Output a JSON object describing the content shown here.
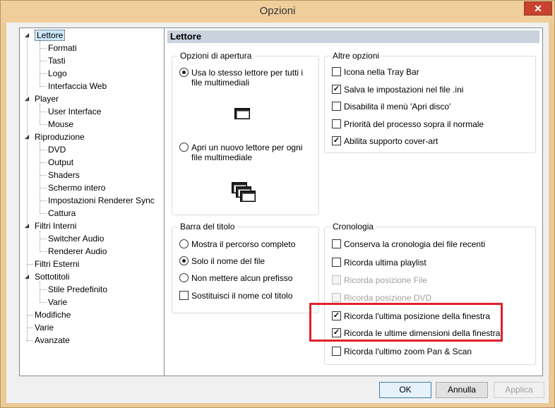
{
  "window": {
    "title": "Opzioni",
    "close_glyph": "✕"
  },
  "tree": {
    "items": [
      {
        "label": "Lettore",
        "level": 0,
        "expanded": true,
        "selected": true
      },
      {
        "label": "Formati",
        "level": 1
      },
      {
        "label": "Tasti",
        "level": 1
      },
      {
        "label": "Logo",
        "level": 1
      },
      {
        "label": "Interfaccia Web",
        "level": 1
      },
      {
        "label": "Player",
        "level": 0,
        "expanded": true
      },
      {
        "label": "User Interface",
        "level": 1
      },
      {
        "label": "Mouse",
        "level": 1
      },
      {
        "label": "Riproduzione",
        "level": 0,
        "expanded": true
      },
      {
        "label": "DVD",
        "level": 1
      },
      {
        "label": "Output",
        "level": 1
      },
      {
        "label": "Shaders",
        "level": 1
      },
      {
        "label": "Schermo intero",
        "level": 1
      },
      {
        "label": "Impostazioni Renderer Sync",
        "level": 1
      },
      {
        "label": "Cattura",
        "level": 1
      },
      {
        "label": "Filtri Interni",
        "level": 0,
        "expanded": true
      },
      {
        "label": "Switcher Audio",
        "level": 1
      },
      {
        "label": "Renderer Audio",
        "level": 1
      },
      {
        "label": "Filtri Esterni",
        "level": 0
      },
      {
        "label": "Sottotitoli",
        "level": 0,
        "expanded": true
      },
      {
        "label": "Stile Predefinito",
        "level": 1
      },
      {
        "label": "Varie",
        "level": 1
      },
      {
        "label": "Modifiche",
        "level": 0
      },
      {
        "label": "Varie",
        "level": 0
      },
      {
        "label": "Avanzate",
        "level": 0
      }
    ]
  },
  "page": {
    "header": "Lettore",
    "apertura": {
      "title": "Opzioni di apertura",
      "opt1": "Usa lo stesso lettore per tutti i file multimediali",
      "opt1_checked": true,
      "opt2": "Apri un nuovo lettore per ogni file multimediale",
      "opt2_checked": false
    },
    "altre": {
      "title": "Altre opzioni",
      "items": [
        {
          "label": "Icona nella Tray Bar",
          "checked": false
        },
        {
          "label": "Salva le impostazioni nel file .ini",
          "checked": true
        },
        {
          "label": "Disabilita il menù 'Apri disco'",
          "checked": false
        },
        {
          "label": "Priorità del processo sopra il normale",
          "checked": false
        },
        {
          "label": "Abilita supporto cover-art",
          "checked": true
        }
      ]
    },
    "titolo": {
      "title": "Barra del titolo",
      "radios": [
        {
          "label": "Mostra il percorso completo",
          "checked": false
        },
        {
          "label": "Solo il nome del file",
          "checked": true
        },
        {
          "label": "Non mettere alcun prefisso",
          "checked": false
        }
      ],
      "checkbox": {
        "label": "Sostituisci il nome col titolo",
        "checked": false
      }
    },
    "cronologia": {
      "title": "Cronologia",
      "items": [
        {
          "label": "Conserva la cronologia dei file recenti",
          "checked": false,
          "disabled": false
        },
        {
          "label": "Ricorda ultima playlist",
          "checked": false,
          "disabled": false
        },
        {
          "label": "Ricorda posizione File",
          "checked": false,
          "disabled": true
        },
        {
          "label": "Ricorda posizione DVD",
          "checked": false,
          "disabled": true
        },
        {
          "label": "Ricorda l'ultima posizione della finestra",
          "checked": true,
          "disabled": false
        },
        {
          "label": "Ricorda le ultime dimensioni della finestra",
          "checked": true,
          "disabled": false
        },
        {
          "label": "Ricorda l'ultimo zoom Pan & Scan",
          "checked": false,
          "disabled": false
        }
      ]
    }
  },
  "buttons": {
    "ok": "OK",
    "cancel": "Annulla",
    "apply": "Applica"
  },
  "colors": {
    "highlight": "#e0202a",
    "titlebar": "#f0ce9c",
    "header": "#c9d2dd"
  }
}
